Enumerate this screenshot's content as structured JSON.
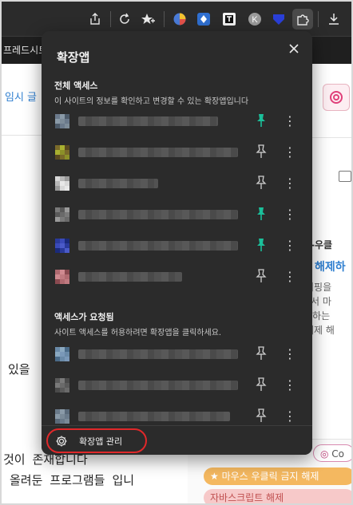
{
  "page": {
    "tab_text": "프레드시트",
    "left_header_text": "임시 글",
    "body_lines": [
      "있을 ",
      "것이 존재합니다",
      "올려둔 프로그램들 입니"
    ],
    "right_texts": [
      "스-우클",
      "해제하",
      "서핑을 ",
      "에서 마",
      "원하는",
      "해제 해"
    ],
    "right_accent": "#2f7fd0",
    "pill_1": "★ 마우스 우클릭 금지 해제",
    "pill_2": "자바스크립트 해제",
    "pill_3": "Co"
  },
  "popup": {
    "title": "확장앱",
    "close_label": "×",
    "section_full": {
      "heading": "전체 액세스",
      "description": "이 사이트의 정보를 확인하고 변경할 수 있는 확장앱입니다",
      "items": [
        {
          "pinned": true
        },
        {
          "pinned": false
        },
        {
          "pinned": false
        },
        {
          "pinned": true
        },
        {
          "pinned": true
        },
        {
          "pinned": false
        }
      ]
    },
    "section_request": {
      "heading": "액세스가 요청됨",
      "description": "사이트 액세스를 허용하려면 확장앱을 클릭하세요.",
      "items": [
        {
          "pinned": false
        },
        {
          "pinned": false
        },
        {
          "pinned": false
        }
      ]
    },
    "manage_label": "확장앱 관리",
    "pin_color": "#1bbf9a",
    "highlight_color": "#e0282a"
  },
  "toolbar": {
    "icons": [
      "share-icon",
      "reload-icon",
      "favorites-icon",
      "extension-icon-1",
      "extension-icon-2",
      "extension-icon-3",
      "profile-k-icon",
      "extension-icon-shield",
      "extensions-puzzle-icon",
      "download-icon"
    ],
    "profile_letter": "K"
  }
}
